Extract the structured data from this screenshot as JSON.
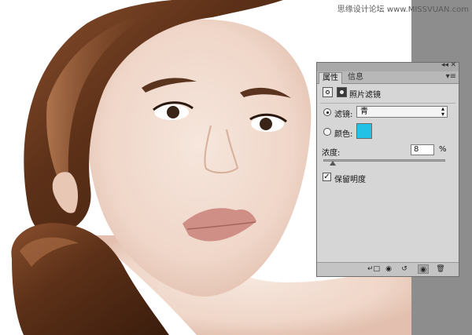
{
  "watermark": "思缘设计论坛 www.MISSVUAN.com",
  "panel": {
    "tabs": [
      {
        "label": "属性"
      },
      {
        "label": "信息"
      }
    ],
    "title": "照片滤镜",
    "filter": {
      "label": "滤镜:",
      "value": "青"
    },
    "color": {
      "label": "颜色:",
      "swatch_color": "#22c2e6"
    },
    "density": {
      "label": "浓度:",
      "value": "8",
      "unit": "%",
      "level_percent": 8
    },
    "preserve_luminosity": {
      "label": "保留明度",
      "checked": true
    },
    "footer_buttons": [
      "clip-to-layer",
      "view-previous-state",
      "reset-to-defaults",
      "toggle-visibility",
      "delete-adjustment"
    ]
  },
  "colors": {
    "panel_bg": "#d6d6d6",
    "strip_gray": "#8d8d8d",
    "swatch": "#22c2e6"
  }
}
